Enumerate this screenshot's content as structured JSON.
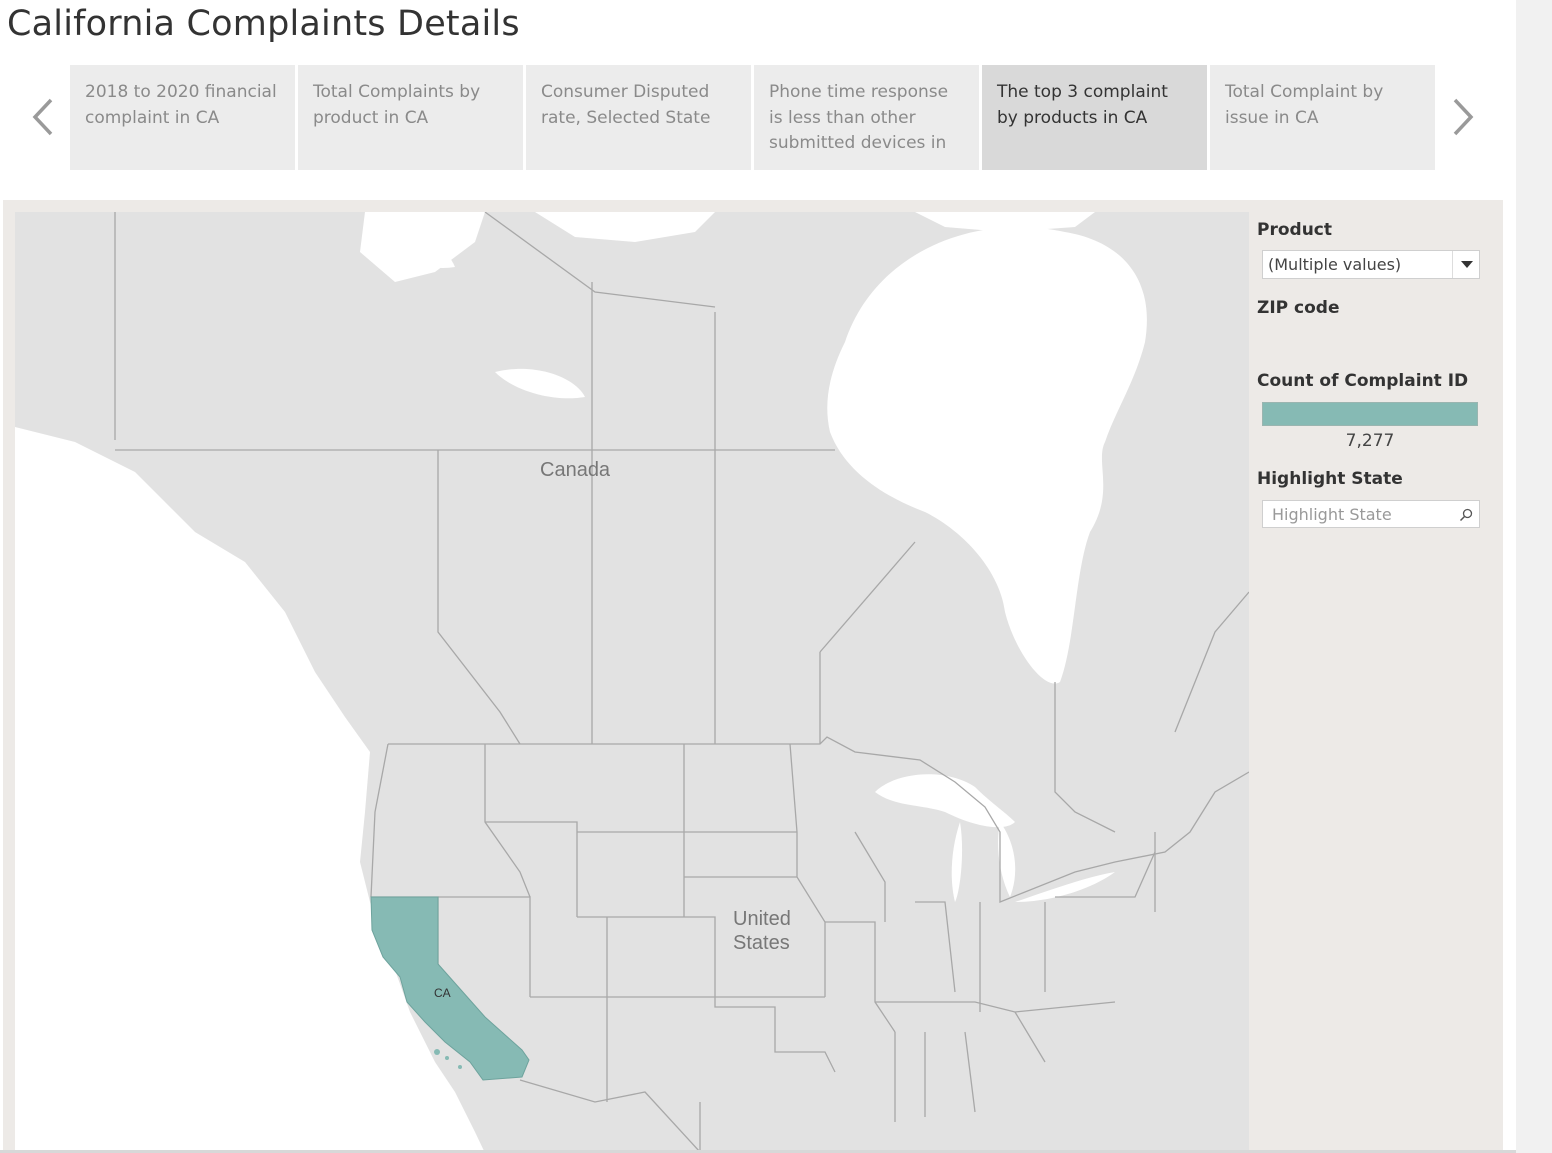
{
  "page": {
    "title": "California Complaints Details"
  },
  "story": {
    "tabs": [
      {
        "label": "2018 to 2020 financial complaint in CA"
      },
      {
        "label": "Total Complaints by product in CA"
      },
      {
        "label": "Consumer Disputed rate, Selected State"
      },
      {
        "label": "Phone time response is less than other submitted devices in"
      },
      {
        "label": "The top 3 complaint by products in CA"
      },
      {
        "label": "Total Complaint by issue in CA"
      }
    ],
    "active_index": 4,
    "nav_icons": [
      "chevron-left-icon",
      "chevron-right-icon"
    ]
  },
  "map": {
    "labels": {
      "canada": "Canada",
      "us_line1": "United",
      "us_line2": "States",
      "highlighted_state": "CA"
    },
    "highlight_color": "#86bab4"
  },
  "filters": {
    "product": {
      "title": "Product",
      "value": "(Multiple values)"
    },
    "zip": {
      "title": "ZIP code"
    },
    "legend": {
      "title": "Count of Complaint ID",
      "value": "7,277"
    },
    "highlight": {
      "title": "Highlight State",
      "placeholder": "Highlight State"
    }
  }
}
